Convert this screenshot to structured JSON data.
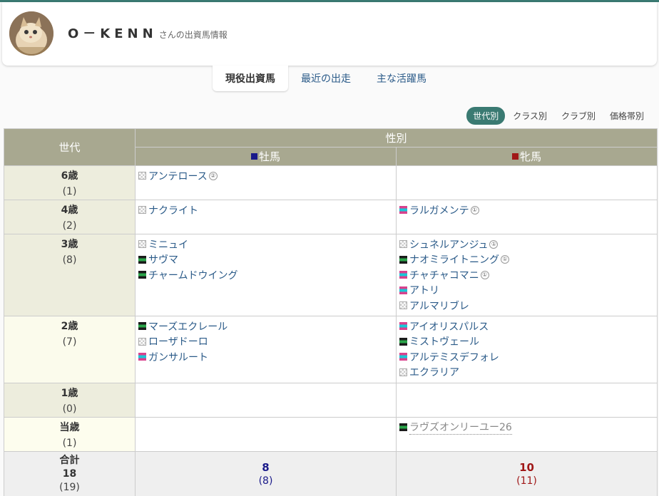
{
  "owner": {
    "name": "O－KENN",
    "suffix": "さんの出資馬情報"
  },
  "tabs": [
    {
      "label": "現役出資馬",
      "active": true
    },
    {
      "label": "最近の出走",
      "active": false
    },
    {
      "label": "主な活躍馬",
      "active": false
    }
  ],
  "filters": [
    {
      "label": "世代別",
      "active": true
    },
    {
      "label": "クラス別",
      "active": false
    },
    {
      "label": "クラブ別",
      "active": false
    },
    {
      "label": "価格帯別",
      "active": false
    }
  ],
  "table": {
    "gen_header": "世代",
    "sex_header": "性別",
    "male_header": "牡馬",
    "female_header": "牝馬",
    "male_color": "#1a1a8a",
    "female_color": "#a01818",
    "rows": [
      {
        "gen": "6歳",
        "count": "(1)",
        "male": [
          {
            "name": "アンテロース",
            "badge": "②",
            "icon": "check"
          }
        ],
        "female": []
      },
      {
        "gen": "4歳",
        "count": "(2)",
        "male": [
          {
            "name": "ナクライト",
            "icon": "check"
          }
        ],
        "female": [
          {
            "name": "ラルガメンテ",
            "badge": "①",
            "icon": "cyan-bar"
          }
        ]
      },
      {
        "gen": "3歳",
        "count": "(8)",
        "male": [
          {
            "name": "ミニュイ",
            "icon": "check"
          },
          {
            "name": "サヴマ",
            "icon": "green-bar"
          },
          {
            "name": "チャームドウイング",
            "icon": "green-bar"
          }
        ],
        "female": [
          {
            "name": "シュネルアンジュ",
            "badge": "①",
            "icon": "check"
          },
          {
            "name": "ナオミライトニング",
            "badge": "①",
            "icon": "green-bar"
          },
          {
            "name": "チャチャコマニ",
            "badge": "①",
            "icon": "cyan-bar"
          },
          {
            "name": "アトリ",
            "icon": "cyan-bar"
          },
          {
            "name": "アルマリブレ",
            "icon": "check"
          }
        ]
      },
      {
        "gen": "2歳",
        "count": "(7)",
        "male": [
          {
            "name": "マーズエクレール",
            "icon": "green-bar"
          },
          {
            "name": "ローザドーロ",
            "icon": "check"
          },
          {
            "name": "ガンサルート",
            "icon": "cyan-bar"
          }
        ],
        "female": [
          {
            "name": "アイオリスパルス",
            "icon": "cyan-bar"
          },
          {
            "name": "ミストヴェール",
            "icon": "green-bar"
          },
          {
            "name": "アルテミスデフォレ",
            "icon": "cyan-bar"
          },
          {
            "name": "エクラリア",
            "icon": "check"
          }
        ]
      },
      {
        "gen": "1歳",
        "count": "(0)",
        "male": [],
        "female": []
      },
      {
        "gen": "当歳",
        "count": "(1)",
        "male": [],
        "female": [
          {
            "name": "ラヴズオンリーユー26",
            "icon": "green-bar",
            "dotted": true
          }
        ]
      }
    ],
    "total": {
      "label": "合計",
      "total": "18",
      "total_sub": "(19)",
      "male": "8",
      "male_sub": "(8)",
      "female": "10",
      "female_sub": "(11)"
    }
  }
}
